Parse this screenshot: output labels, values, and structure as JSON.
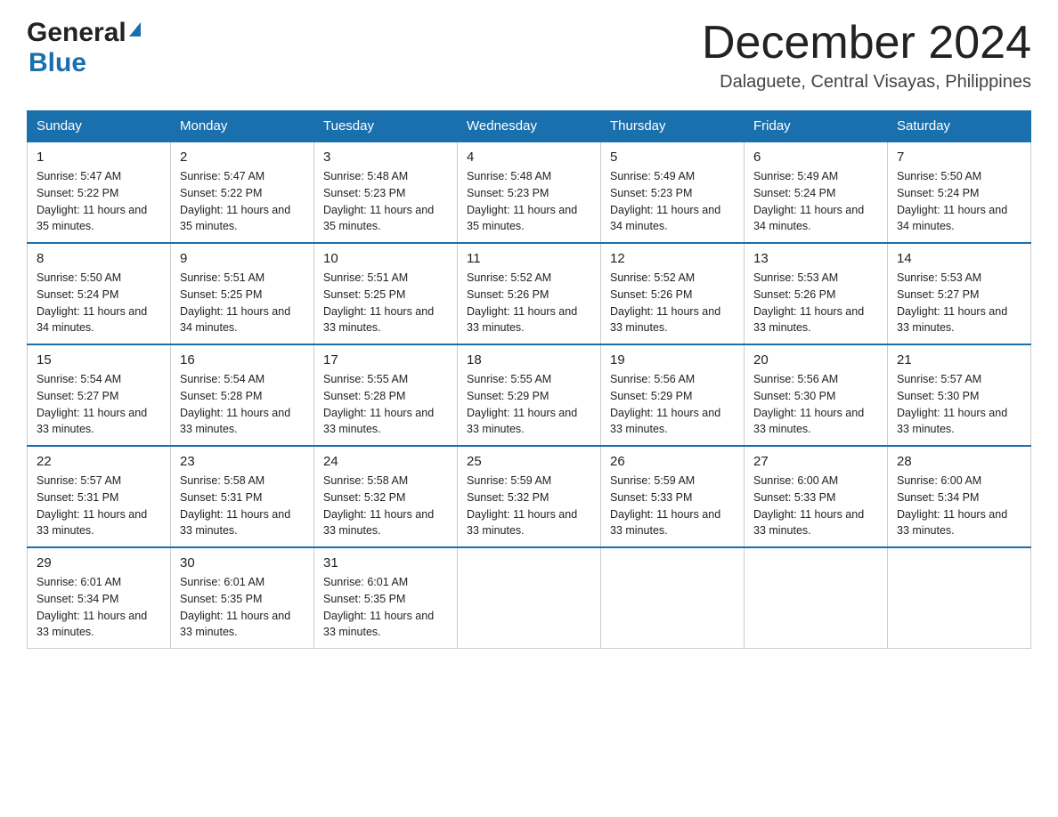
{
  "header": {
    "logo_general": "General",
    "logo_blue": "Blue",
    "month_title": "December 2024",
    "location": "Dalaguete, Central Visayas, Philippines"
  },
  "days_of_week": [
    "Sunday",
    "Monday",
    "Tuesday",
    "Wednesday",
    "Thursday",
    "Friday",
    "Saturday"
  ],
  "weeks": [
    [
      {
        "day": "1",
        "sunrise": "5:47 AM",
        "sunset": "5:22 PM",
        "daylight": "11 hours and 35 minutes."
      },
      {
        "day": "2",
        "sunrise": "5:47 AM",
        "sunset": "5:22 PM",
        "daylight": "11 hours and 35 minutes."
      },
      {
        "day": "3",
        "sunrise": "5:48 AM",
        "sunset": "5:23 PM",
        "daylight": "11 hours and 35 minutes."
      },
      {
        "day": "4",
        "sunrise": "5:48 AM",
        "sunset": "5:23 PM",
        "daylight": "11 hours and 35 minutes."
      },
      {
        "day": "5",
        "sunrise": "5:49 AM",
        "sunset": "5:23 PM",
        "daylight": "11 hours and 34 minutes."
      },
      {
        "day": "6",
        "sunrise": "5:49 AM",
        "sunset": "5:24 PM",
        "daylight": "11 hours and 34 minutes."
      },
      {
        "day": "7",
        "sunrise": "5:50 AM",
        "sunset": "5:24 PM",
        "daylight": "11 hours and 34 minutes."
      }
    ],
    [
      {
        "day": "8",
        "sunrise": "5:50 AM",
        "sunset": "5:24 PM",
        "daylight": "11 hours and 34 minutes."
      },
      {
        "day": "9",
        "sunrise": "5:51 AM",
        "sunset": "5:25 PM",
        "daylight": "11 hours and 34 minutes."
      },
      {
        "day": "10",
        "sunrise": "5:51 AM",
        "sunset": "5:25 PM",
        "daylight": "11 hours and 33 minutes."
      },
      {
        "day": "11",
        "sunrise": "5:52 AM",
        "sunset": "5:26 PM",
        "daylight": "11 hours and 33 minutes."
      },
      {
        "day": "12",
        "sunrise": "5:52 AM",
        "sunset": "5:26 PM",
        "daylight": "11 hours and 33 minutes."
      },
      {
        "day": "13",
        "sunrise": "5:53 AM",
        "sunset": "5:26 PM",
        "daylight": "11 hours and 33 minutes."
      },
      {
        "day": "14",
        "sunrise": "5:53 AM",
        "sunset": "5:27 PM",
        "daylight": "11 hours and 33 minutes."
      }
    ],
    [
      {
        "day": "15",
        "sunrise": "5:54 AM",
        "sunset": "5:27 PM",
        "daylight": "11 hours and 33 minutes."
      },
      {
        "day": "16",
        "sunrise": "5:54 AM",
        "sunset": "5:28 PM",
        "daylight": "11 hours and 33 minutes."
      },
      {
        "day": "17",
        "sunrise": "5:55 AM",
        "sunset": "5:28 PM",
        "daylight": "11 hours and 33 minutes."
      },
      {
        "day": "18",
        "sunrise": "5:55 AM",
        "sunset": "5:29 PM",
        "daylight": "11 hours and 33 minutes."
      },
      {
        "day": "19",
        "sunrise": "5:56 AM",
        "sunset": "5:29 PM",
        "daylight": "11 hours and 33 minutes."
      },
      {
        "day": "20",
        "sunrise": "5:56 AM",
        "sunset": "5:30 PM",
        "daylight": "11 hours and 33 minutes."
      },
      {
        "day": "21",
        "sunrise": "5:57 AM",
        "sunset": "5:30 PM",
        "daylight": "11 hours and 33 minutes."
      }
    ],
    [
      {
        "day": "22",
        "sunrise": "5:57 AM",
        "sunset": "5:31 PM",
        "daylight": "11 hours and 33 minutes."
      },
      {
        "day": "23",
        "sunrise": "5:58 AM",
        "sunset": "5:31 PM",
        "daylight": "11 hours and 33 minutes."
      },
      {
        "day": "24",
        "sunrise": "5:58 AM",
        "sunset": "5:32 PM",
        "daylight": "11 hours and 33 minutes."
      },
      {
        "day": "25",
        "sunrise": "5:59 AM",
        "sunset": "5:32 PM",
        "daylight": "11 hours and 33 minutes."
      },
      {
        "day": "26",
        "sunrise": "5:59 AM",
        "sunset": "5:33 PM",
        "daylight": "11 hours and 33 minutes."
      },
      {
        "day": "27",
        "sunrise": "6:00 AM",
        "sunset": "5:33 PM",
        "daylight": "11 hours and 33 minutes."
      },
      {
        "day": "28",
        "sunrise": "6:00 AM",
        "sunset": "5:34 PM",
        "daylight": "11 hours and 33 minutes."
      }
    ],
    [
      {
        "day": "29",
        "sunrise": "6:01 AM",
        "sunset": "5:34 PM",
        "daylight": "11 hours and 33 minutes."
      },
      {
        "day": "30",
        "sunrise": "6:01 AM",
        "sunset": "5:35 PM",
        "daylight": "11 hours and 33 minutes."
      },
      {
        "day": "31",
        "sunrise": "6:01 AM",
        "sunset": "5:35 PM",
        "daylight": "11 hours and 33 minutes."
      },
      null,
      null,
      null,
      null
    ]
  ]
}
